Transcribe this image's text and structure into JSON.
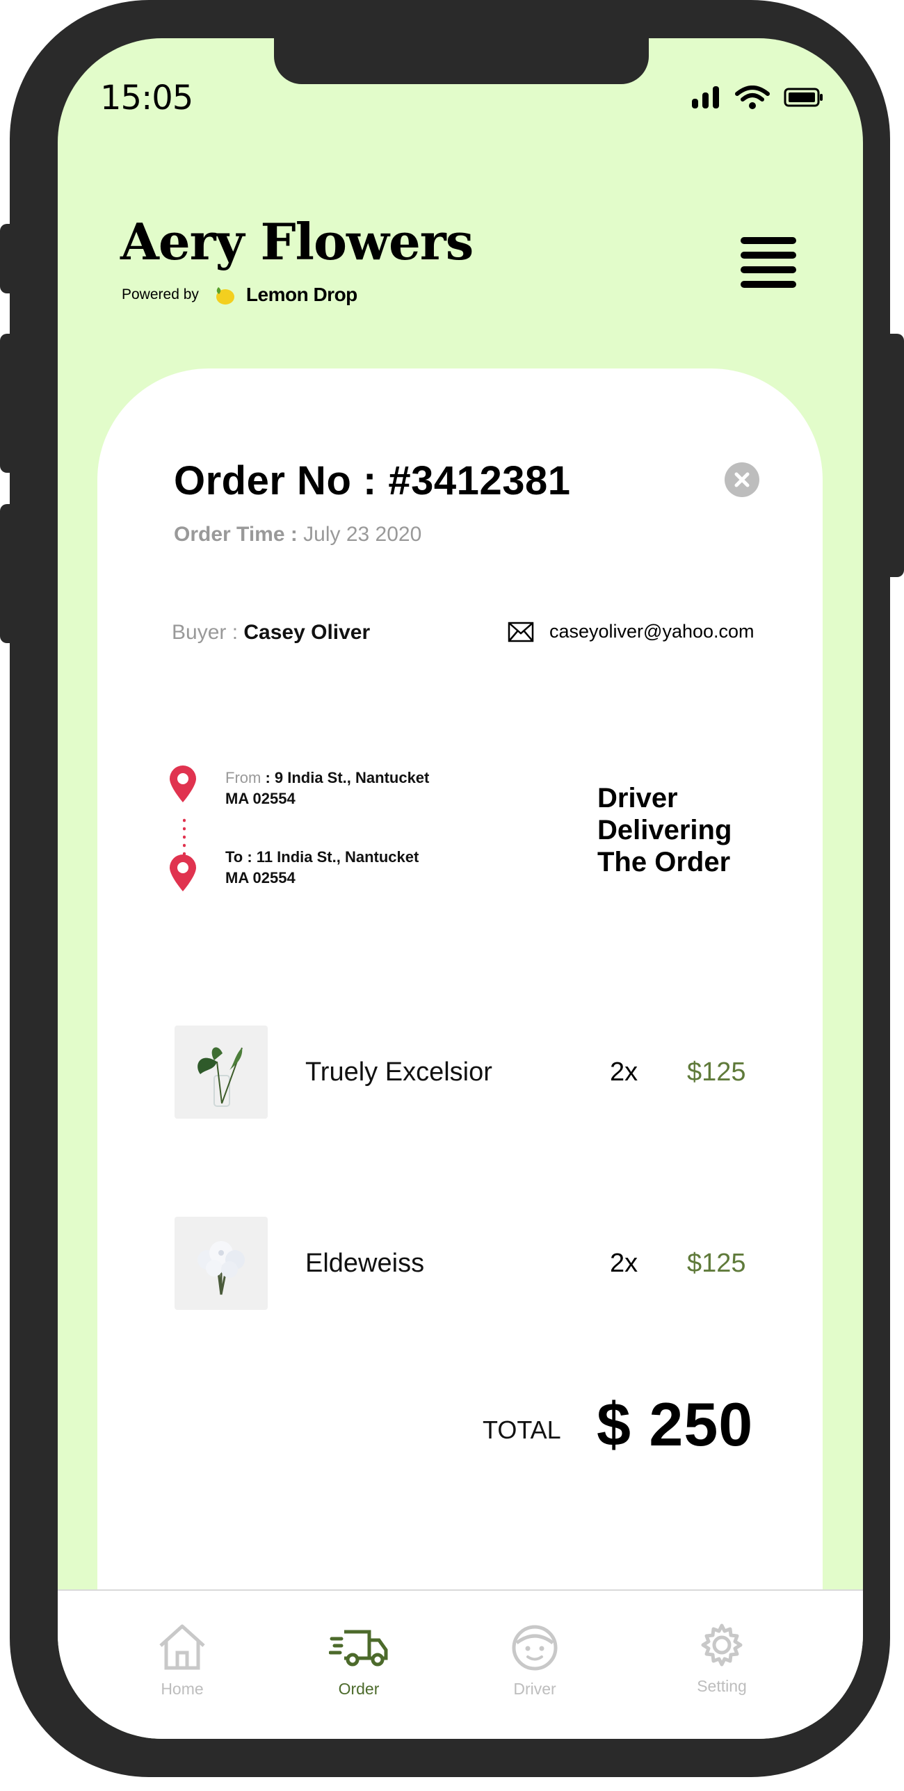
{
  "status_bar": {
    "time": "15:05"
  },
  "brand": {
    "title": "Aery Flowers",
    "powered_by": "Powered by",
    "partner": "Lemon Drop"
  },
  "order": {
    "number_label": "Order No : #3412381",
    "time_label": "Order Time : ",
    "time_value": "July 23 2020",
    "buyer_label": "Buyer : ",
    "buyer_name": "Casey Oliver",
    "buyer_email": "caseyoliver@yahoo.com",
    "from_label": "From",
    "from_address_line1": " : 9 India St., Nantucket",
    "from_address_line2": "MA 02554",
    "to_label": "To",
    "to_address_line1": " : 11 India St., Nantucket",
    "to_address_line2": "MA 02554",
    "status_line1": "Driver",
    "status_line2": "Delivering",
    "status_line3": "The Order",
    "items": [
      {
        "name": "Truely Excelsior",
        "qty": "2x",
        "price": "$125"
      },
      {
        "name": "Eldeweiss",
        "qty": "2x",
        "price": "$125"
      }
    ],
    "total_label": "TOTAL",
    "total_value": "$ 250"
  },
  "tabs": [
    {
      "label": "Home",
      "icon": "home-icon"
    },
    {
      "label": "Order",
      "icon": "delivery-truck-icon"
    },
    {
      "label": "Driver",
      "icon": "driver-face-icon"
    },
    {
      "label": "Setting",
      "icon": "gear-icon"
    }
  ],
  "colors": {
    "background": "#e2fcca",
    "accent_green": "#4c6a2b",
    "price_green": "#5f7a3a",
    "pin_red": "#e0334f",
    "phone_frame": "#2a2a2a"
  }
}
